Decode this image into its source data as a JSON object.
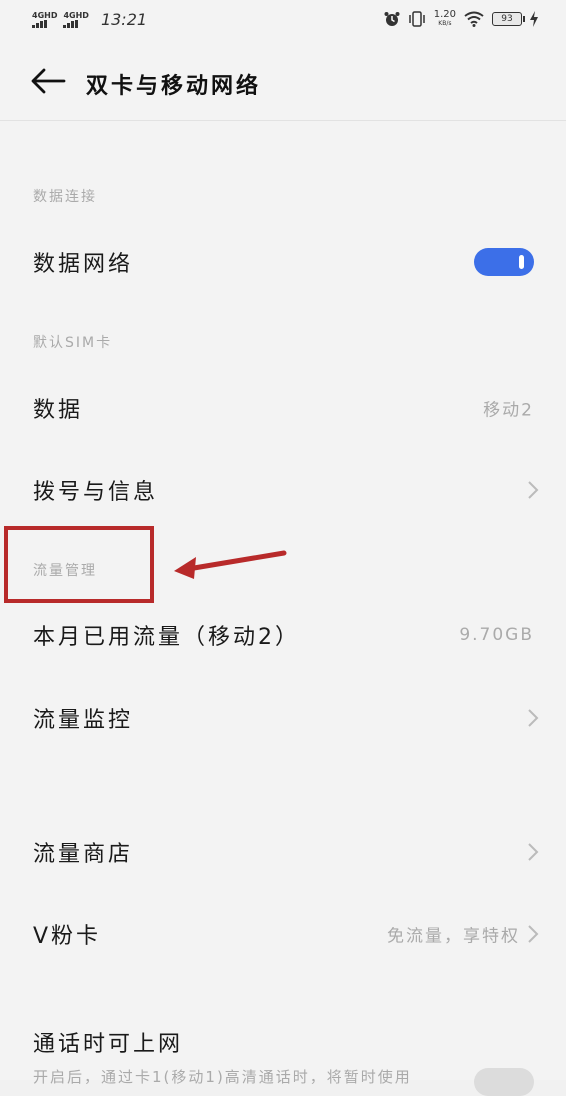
{
  "status_bar": {
    "sim1_network": "4GHD",
    "sim2_network": "4GHD",
    "time": "13:21",
    "speed_value": "1.20",
    "speed_unit": "KB/s",
    "battery": "93"
  },
  "header": {
    "title": "双卡与移动网络"
  },
  "sections": {
    "data_connection": "数据连接",
    "default_sim": "默认SIM卡",
    "traffic_management": "流量管理"
  },
  "rows": {
    "data_network": {
      "label": "数据网络",
      "toggle_on": true
    },
    "data": {
      "label": "数据",
      "value": "移动2"
    },
    "call_sms": {
      "label": "拨号与信息"
    },
    "monthly_usage": {
      "label": "本月已用流量（移动2）",
      "value": "9.70GB"
    },
    "traffic_monitor": {
      "label": "流量监控"
    },
    "traffic_store": {
      "label": "流量商店"
    },
    "v_fan_card": {
      "label": "V粉卡",
      "value": "免流量，享特权"
    },
    "online_during_call": {
      "label": "通话时可上网",
      "subtext": "开启后，通过卡1(移动1)高清通话时，将暂时使用"
    }
  },
  "colors": {
    "accent": "#3c6fe8",
    "annotation": "#b82a2a"
  }
}
